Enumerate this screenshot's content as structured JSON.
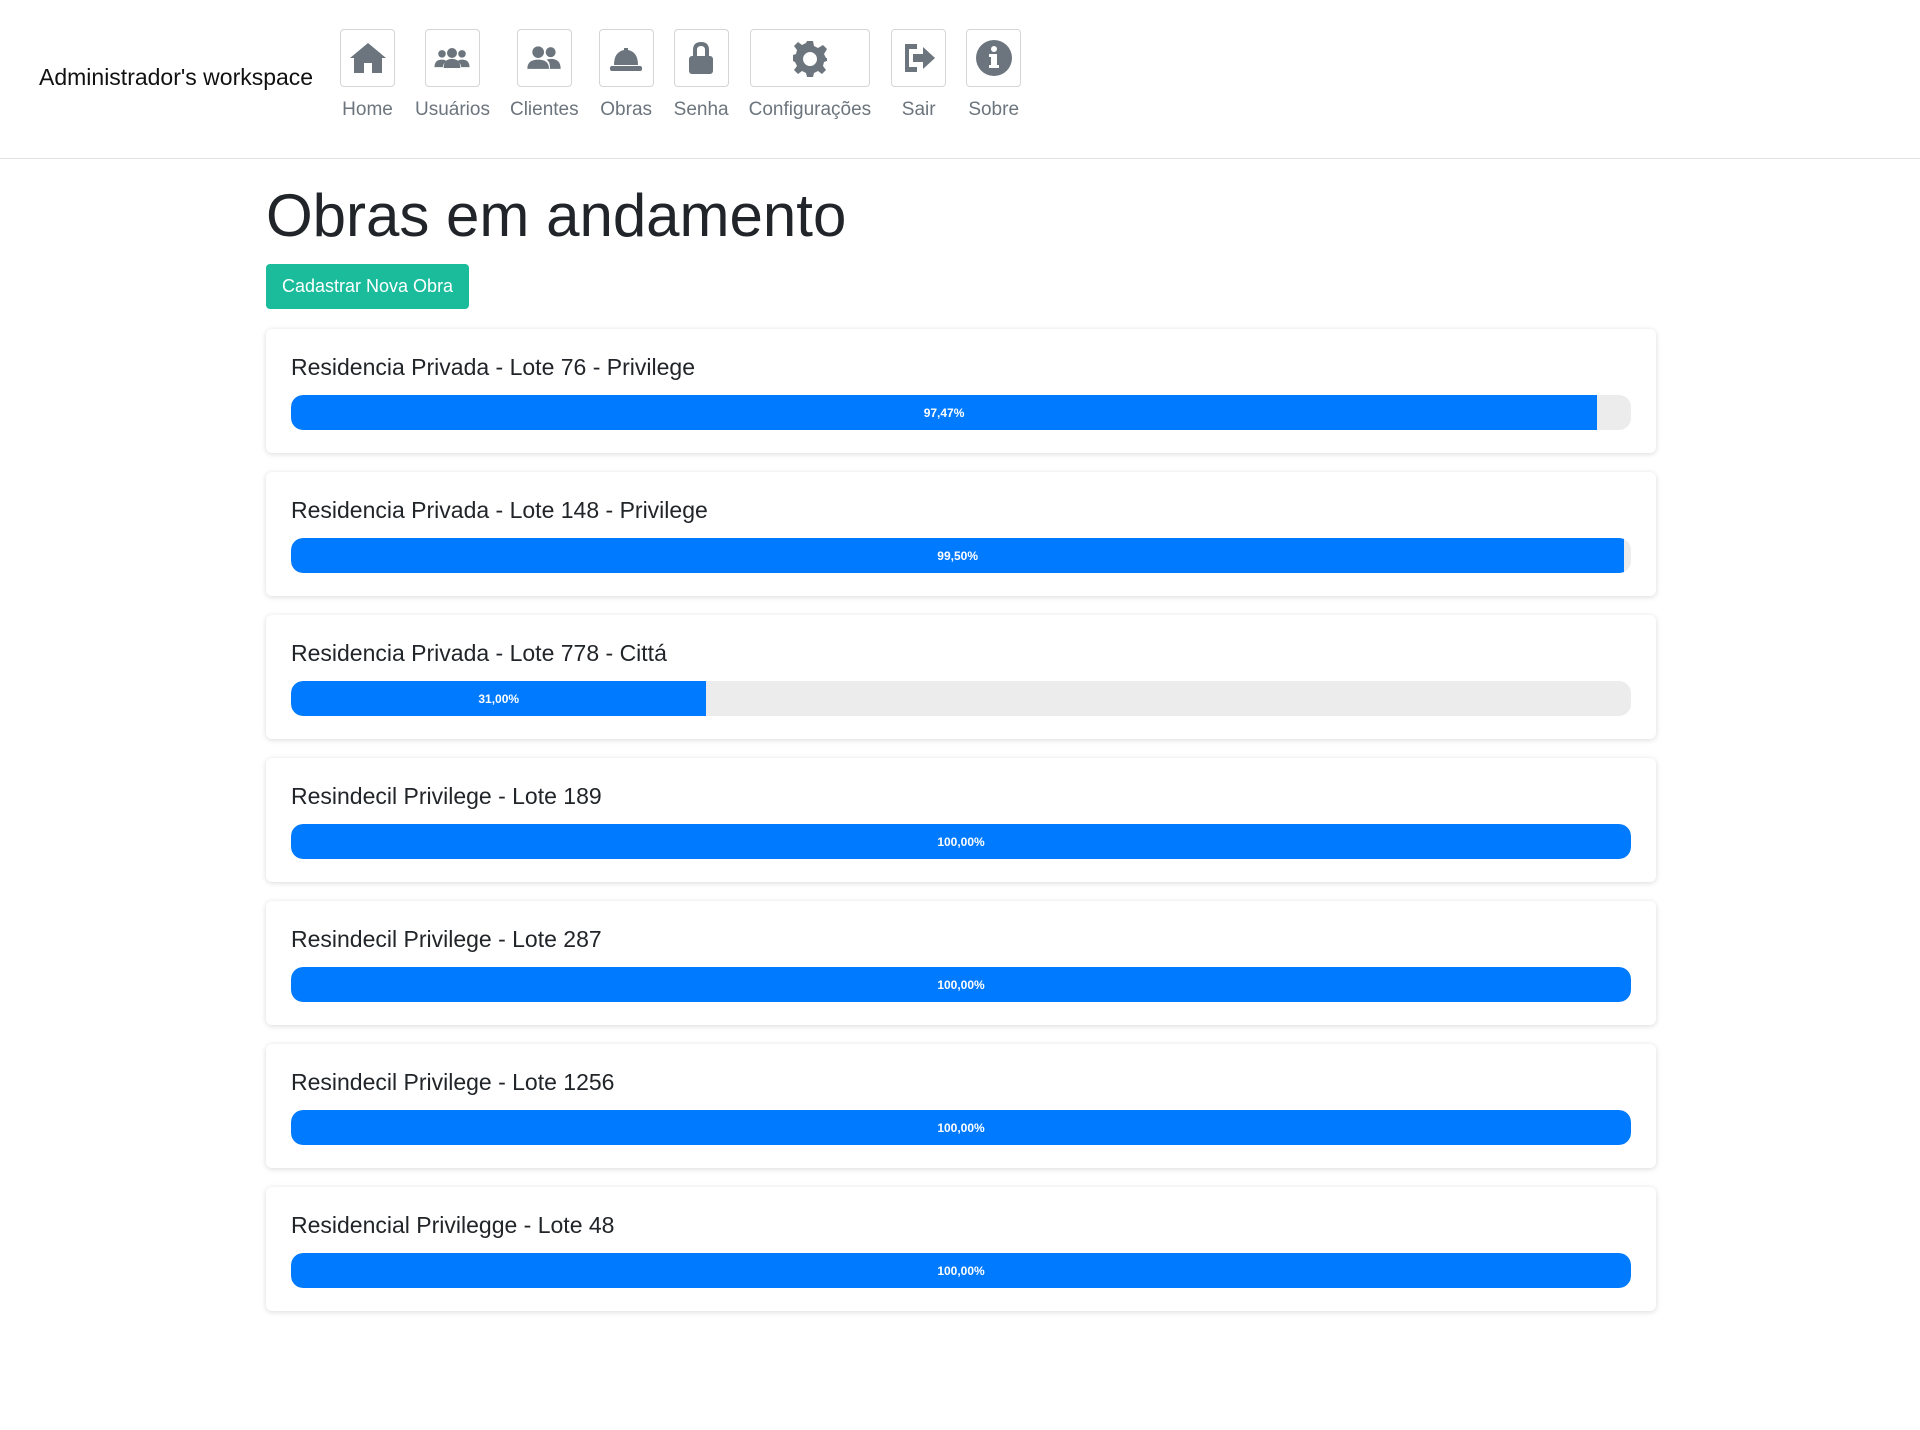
{
  "header": {
    "brand": "Administrador's workspace",
    "nav": [
      {
        "label": "Home",
        "icon": "home-icon"
      },
      {
        "label": "Usuários",
        "icon": "users-group-icon"
      },
      {
        "label": "Clientes",
        "icon": "clients-icon"
      },
      {
        "label": "Obras",
        "icon": "hard-hat-icon"
      },
      {
        "label": "Senha",
        "icon": "lock-icon"
      },
      {
        "label": "Configurações",
        "icon": "gear-icon"
      },
      {
        "label": "Sair",
        "icon": "sign-out-icon"
      },
      {
        "label": "Sobre",
        "icon": "info-icon"
      }
    ]
  },
  "main": {
    "title": "Obras em andamento",
    "new_button": "Cadastrar Nova Obra",
    "projects": [
      {
        "name": "Residencia Privada - Lote 76 - Privilege",
        "progress_label": "97,47%",
        "progress": 97.47
      },
      {
        "name": "Residencia Privada - Lote 148 - Privilege",
        "progress_label": "99,50%",
        "progress": 99.5
      },
      {
        "name": "Residencia Privada - Lote 778 - Cittá",
        "progress_label": "31,00%",
        "progress": 31.0
      },
      {
        "name": "Resindecil Privilege - Lote 189",
        "progress_label": "100,00%",
        "progress": 100.0
      },
      {
        "name": "Resindecil Privilege - Lote 287",
        "progress_label": "100,00%",
        "progress": 100.0
      },
      {
        "name": "Resindecil Privilege - Lote 1256",
        "progress_label": "100,00%",
        "progress": 100.0
      },
      {
        "name": "Residencial Privilegge - Lote 48",
        "progress_label": "100,00%",
        "progress": 100.0
      }
    ]
  },
  "colors": {
    "accent": "#007bff",
    "primary_button": "#1abc9c",
    "icon": "#6c757d",
    "track": "#ececec"
  }
}
